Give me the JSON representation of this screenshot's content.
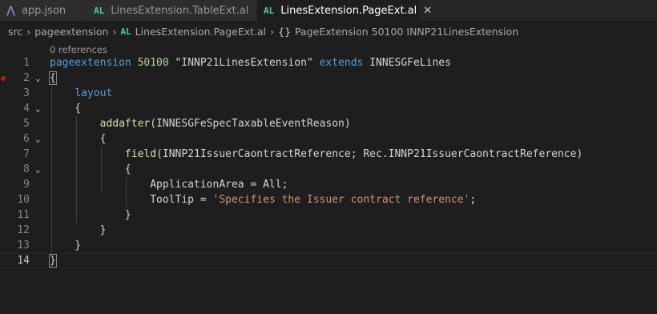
{
  "tabs": [
    {
      "icon": "vs-icon",
      "label": "app.json",
      "active": false
    },
    {
      "icon": "AL",
      "label": "LinesExtension.TableExt.al",
      "active": false
    },
    {
      "icon": "AL",
      "label": "LinesExtension.PageExt.al",
      "active": true,
      "close": "✕"
    }
  ],
  "breadcrumb": {
    "items": [
      "src",
      "pageextension",
      "LinesExtension.PageExt.al",
      "PageExtension 50100 INNP21LinesExtension"
    ],
    "al_icon": "AL",
    "braces_icon": "{}",
    "separator": "›"
  },
  "editor": {
    "codelens": "0 references",
    "lines": [
      {
        "n": "1",
        "code": "pageextension 50100 \"INNP21LinesExtension\" extends INNESGFeLines"
      },
      {
        "n": "2",
        "code": "{"
      },
      {
        "n": "3",
        "code": "    layout"
      },
      {
        "n": "4",
        "code": "    {"
      },
      {
        "n": "5",
        "code": "        addafter(INNESGFeSpecTaxableEventReason)"
      },
      {
        "n": "6",
        "code": "        {"
      },
      {
        "n": "7",
        "code": "            field(INNP21IssuerCaontractReference; Rec.INNP21IssuerCaontractReference)"
      },
      {
        "n": "8",
        "code": "            {"
      },
      {
        "n": "9",
        "code": "                ApplicationArea = All;"
      },
      {
        "n": "10",
        "code": "                ToolTip = 'Specifies the Issuer contract reference';"
      },
      {
        "n": "11",
        "code": "            }"
      },
      {
        "n": "12",
        "code": "        }"
      },
      {
        "n": "13",
        "code": "    }"
      },
      {
        "n": "14",
        "code": "}"
      }
    ]
  },
  "colors": {
    "keyword": "#569cd6",
    "string": "#ce9178",
    "number": "#b5cea8",
    "function": "#dcdcaa",
    "al_icon": "#4ec9b0",
    "breakpoint": "#a1260d"
  }
}
